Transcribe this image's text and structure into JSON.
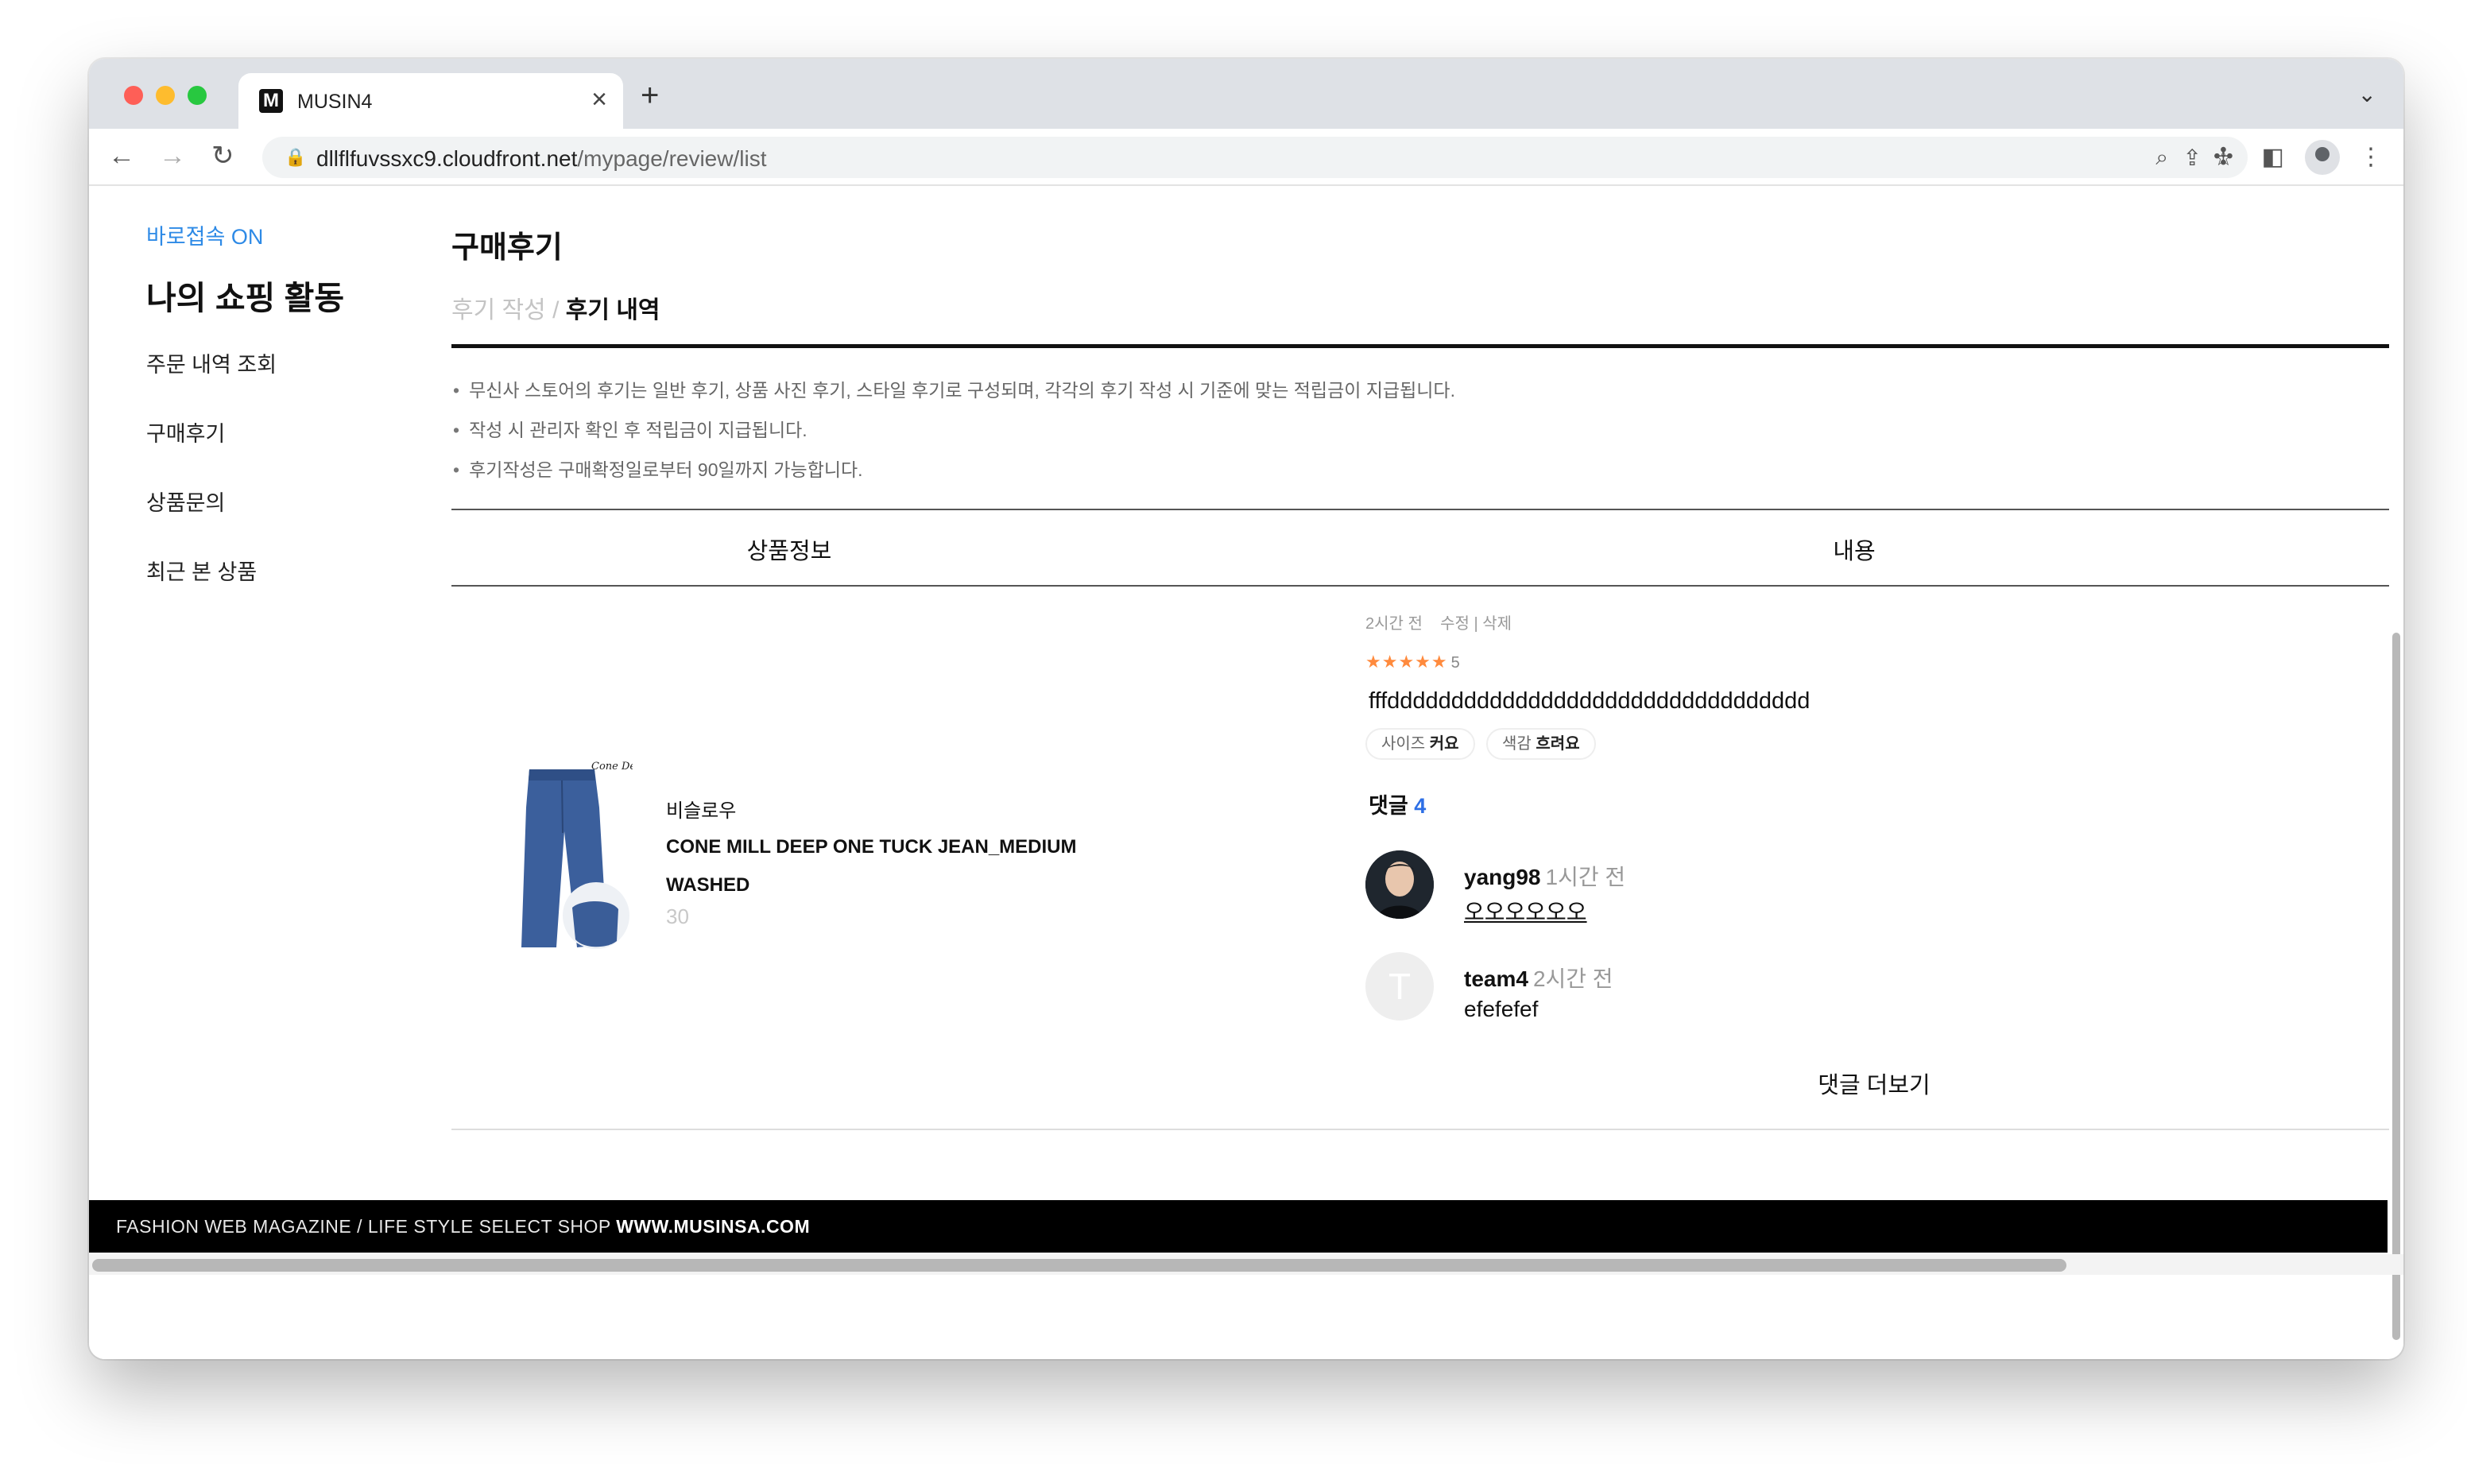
{
  "browser": {
    "tab_title": "MUSIN4",
    "favicon_letter": "M",
    "url_host": "dllflfuvssxc9.cloudfront.net",
    "url_path": "/mypage/review/list"
  },
  "sidebar": {
    "quick_access": "바로접속 ON",
    "title": "나의 쇼핑 활동",
    "items": [
      {
        "label": "주문 내역 조회"
      },
      {
        "label": "구매후기"
      },
      {
        "label": "상품문의"
      },
      {
        "label": "최근 본 상품"
      }
    ]
  },
  "main": {
    "title": "구매후기",
    "breadcrumb": {
      "inactive": "후기 작성",
      "separator": "/",
      "active": "후기 내역"
    },
    "notices": [
      "무신사 스토어의 후기는 일반 후기, 상품 사진 후기, 스타일 후기로 구성되며, 각각의 후기 작성 시 기준에 맞는 적립금이 지급됩니다.",
      "작성 시 관리자 확인 후 적립금이 지급됩니다.",
      "후기작성은 구매확정일로부터 90일까지 가능합니다."
    ],
    "columns": {
      "product": "상품정보",
      "content": "내용"
    }
  },
  "review": {
    "product": {
      "brand": "비슬로우",
      "name": "CONE MILL DEEP ONE TUCK JEAN_MEDIUM WASHED",
      "option": "30",
      "logo_text": "Cone Denim"
    },
    "time": "2시간 전",
    "edit_label": "수정",
    "separator": "|",
    "delete_label": "삭제",
    "stars": "★★★★★",
    "rating": "5",
    "text": "fffddddddddddddddddddddddddddddddddd",
    "tags": [
      {
        "key": "사이즈",
        "value": "커요"
      },
      {
        "key": "색감",
        "value": "흐려요"
      }
    ],
    "comments_label": "댓글",
    "comments_count": "4",
    "comments": [
      {
        "user": "yang98",
        "time": "1시간 전",
        "text": "오오오오오오"
      },
      {
        "user": "team4",
        "time": "2시간 전",
        "text": "efefefef",
        "avatar_letter": "T"
      }
    ],
    "more_comments": "댓글 더보기"
  },
  "footer": {
    "text": "FASHION WEB MAGAZINE / LIFE STYLE SELECT SHOP",
    "site": "WWW.MUSINSA.COM"
  }
}
